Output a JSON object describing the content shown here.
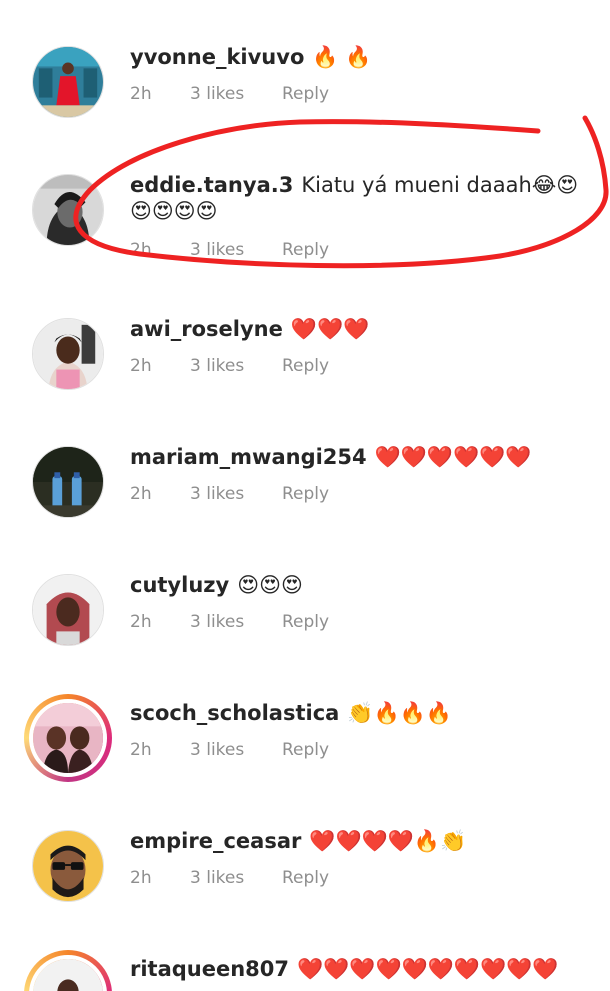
{
  "colors": {
    "annotation": "#ee2222",
    "username": "#262626",
    "meta": "#8e8e8e"
  },
  "comments": [
    {
      "username": "yvonne_kivuvo",
      "text": "🔥 🔥",
      "time": "2h",
      "likes": "3 likes",
      "reply": "Reply",
      "avatar": "woman-in-red-dress-avatar"
    },
    {
      "username": "eddie.tanya.3",
      "text": "Kiatu yá mueni daaah😂😍😍😍😍😍",
      "time": "2h",
      "likes": "3 likes",
      "reply": "Reply",
      "avatar": "woman-black-and-white-avatar"
    },
    {
      "username": "awi_roselyne",
      "text": "❤️❤️❤️",
      "time": "2h",
      "likes": "3 likes",
      "reply": "Reply",
      "avatar": "woman-selfie-avatar"
    },
    {
      "username": "mariam_mwangi254",
      "text": "❤️❤️❤️❤️❤️❤️",
      "time": "2h",
      "likes": "3 likes",
      "reply": "Reply",
      "avatar": "water-bottles-avatar"
    },
    {
      "username": "cutyluzy",
      "text": "😍😍😍",
      "time": "2h",
      "likes": "3 likes",
      "reply": "Reply",
      "avatar": "braided-hair-avatar"
    },
    {
      "username": "scoch_scholastica",
      "text": "👏🔥🔥🔥",
      "time": "2h",
      "likes": "3 likes",
      "reply": "Reply",
      "avatar": "two-women-story-avatar"
    },
    {
      "username": "empire_ceasar",
      "text": "❤️❤️❤️❤️🔥👏",
      "time": "2h",
      "likes": "3 likes",
      "reply": "Reply",
      "avatar": "man-with-sunglasses-avatar"
    },
    {
      "username": "ritaqueen807",
      "text": "❤️❤️❤️❤️❤️❤️❤️❤️❤️❤️",
      "time": "",
      "likes": "",
      "reply": "",
      "avatar": "woman-story-avatar"
    }
  ]
}
